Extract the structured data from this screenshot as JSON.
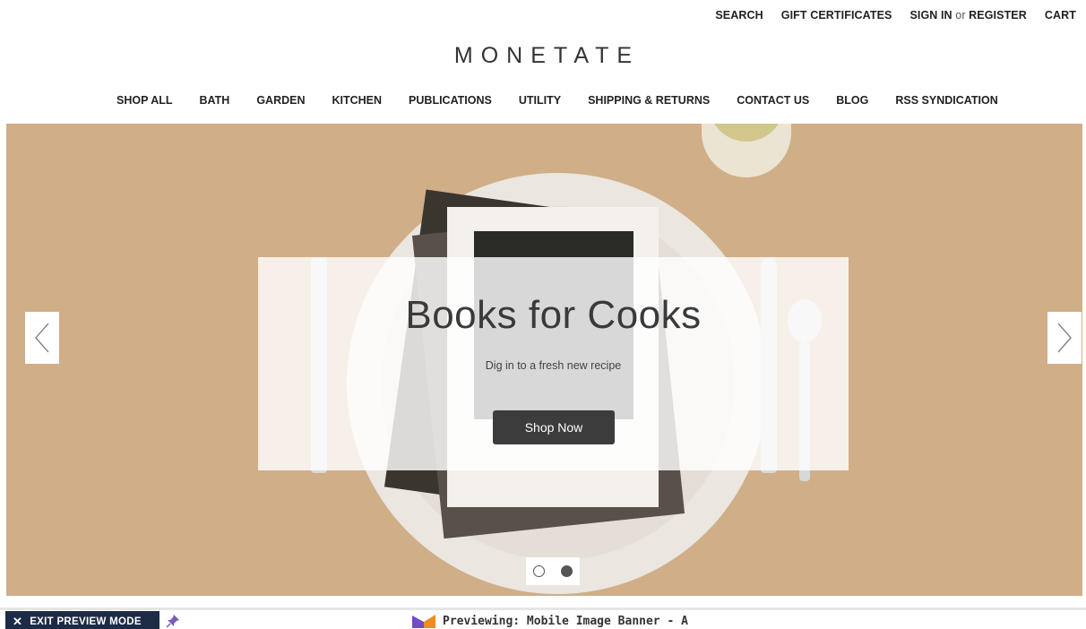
{
  "utility_nav": {
    "search": "SEARCH",
    "gift_certificates": "GIFT CERTIFICATES",
    "sign_in": "SIGN IN",
    "or": "or",
    "register": "REGISTER",
    "cart": "CART"
  },
  "brand": {
    "name": "MONETATE"
  },
  "main_nav": {
    "items": [
      {
        "label": "SHOP ALL"
      },
      {
        "label": "BATH"
      },
      {
        "label": "GARDEN"
      },
      {
        "label": "KITCHEN"
      },
      {
        "label": "PUBLICATIONS"
      },
      {
        "label": "UTILITY"
      },
      {
        "label": "SHIPPING & RETURNS"
      },
      {
        "label": "CONTACT US"
      },
      {
        "label": "BLOG"
      },
      {
        "label": "RSS SYNDICATION"
      }
    ]
  },
  "hero": {
    "title": "Books for Cooks",
    "subtitle": "Dig in to a fresh new recipe",
    "cta_label": "Shop Now",
    "prev_icon": "chevron-left-icon",
    "next_icon": "chevron-right-icon",
    "slides_total": 2,
    "active_slide": 2,
    "background_color": "#cfae88"
  },
  "preview_bar": {
    "exit_label": "EXIT PREVIEW MODE",
    "exit_icon": "close-icon",
    "pin_icon": "pin-icon",
    "preview_text": "Previewing: Mobile Image Banner - A",
    "brand_icon": "monetate-logo-icon",
    "accent_color": "#1d2b46"
  }
}
